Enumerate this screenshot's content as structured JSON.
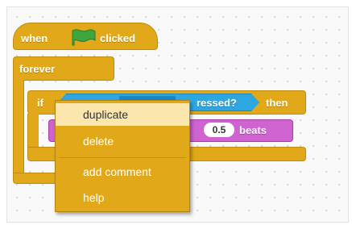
{
  "script": {
    "hat_block": {
      "text_when": "when",
      "text_clicked": "clicked",
      "icon": "green-flag-icon"
    },
    "forever_block": {
      "label": "forever"
    },
    "if_block": {
      "label_if": "if",
      "label_then": "then"
    },
    "sensing_block": {
      "label_fragment": "ressed?"
    },
    "sound_block": {
      "beats_value": "0.5",
      "beats_label": "beats"
    }
  },
  "context_menu": {
    "items": [
      {
        "label": "duplicate",
        "highlighted": true
      },
      {
        "label": "delete"
      },
      {
        "label": "add comment"
      },
      {
        "label": "help"
      }
    ]
  },
  "colors": {
    "control": "#e1a91a",
    "sensing": "#2ea7e0",
    "sound": "#cf63cf",
    "flag": "#3fa63f",
    "menu_highlight": "#fbe6ae"
  }
}
